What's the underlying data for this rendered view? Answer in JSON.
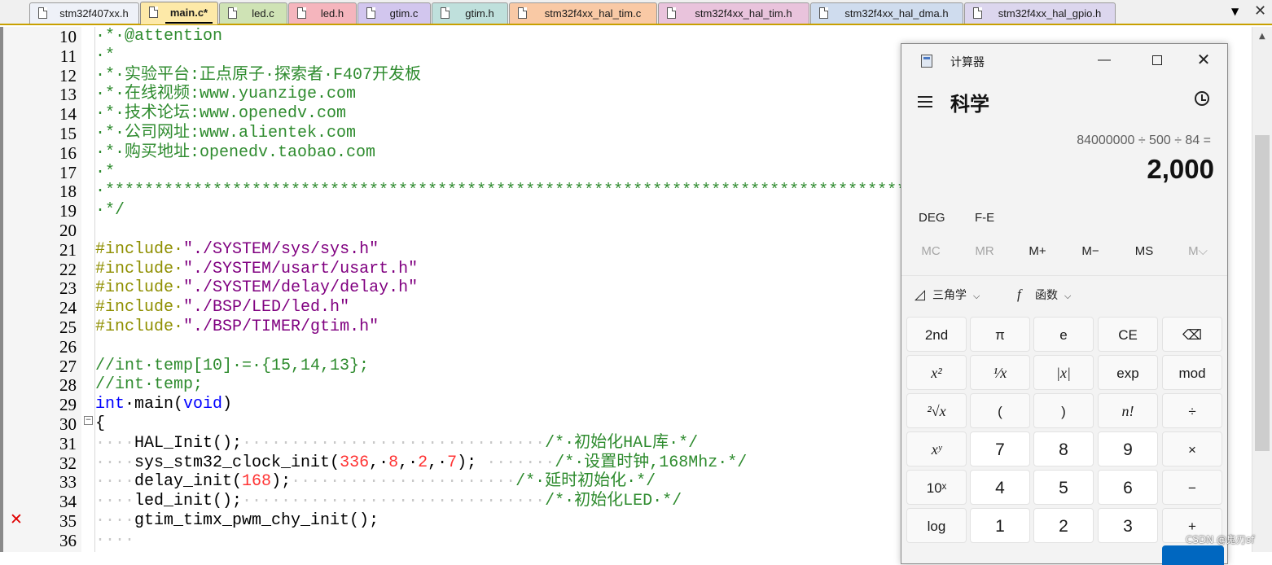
{
  "tabs": [
    {
      "label": "stm32f407xx.h",
      "color": "#eef1f8",
      "width": 135
    },
    {
      "label": "main.c*",
      "color": "#fde9a8",
      "width": 96,
      "active": true
    },
    {
      "label": "led.c",
      "color": "#cfe3b5",
      "width": 84
    },
    {
      "label": "led.h",
      "color": "#f5b5bd",
      "width": 84
    },
    {
      "label": "gtim.c",
      "color": "#d2c6ee",
      "width": 90
    },
    {
      "label": "gtim.h",
      "color": "#bfe0dc",
      "width": 94
    },
    {
      "label": "stm32f4xx_hal_tim.c",
      "color": "#f9c9a5",
      "width": 182
    },
    {
      "label": "stm32f4xx_hal_tim.h",
      "color": "#e9c3dc",
      "width": 186
    },
    {
      "label": "stm32f4xx_hal_dma.h",
      "color": "#cfdcee",
      "width": 188
    },
    {
      "label": "stm32f4xx_hal_gpio.h",
      "color": "#dcd6ee",
      "width": 186
    }
  ],
  "tabbar": {
    "dropdown_icon": "▼",
    "close_icon": "✕"
  },
  "editor": {
    "error_marker": "✕",
    "fold_marker": "−",
    "lines": [
      {
        "n": "10",
        "segs": [
          [
            "c-com",
            "·*·@attention"
          ]
        ]
      },
      {
        "n": "11",
        "segs": [
          [
            "c-com",
            "·*"
          ]
        ]
      },
      {
        "n": "12",
        "segs": [
          [
            "c-com",
            "·*·实验平台:正点原子·探索者·F407开发板"
          ]
        ]
      },
      {
        "n": "13",
        "segs": [
          [
            "c-com",
            "·*·在线视频:www.yuanzige.com"
          ]
        ]
      },
      {
        "n": "14",
        "segs": [
          [
            "c-com",
            "·*·技术论坛:www.openedv.com"
          ]
        ]
      },
      {
        "n": "15",
        "segs": [
          [
            "c-com",
            "·*·公司网址:www.alientek.com"
          ]
        ]
      },
      {
        "n": "16",
        "segs": [
          [
            "c-com",
            "·*·购买地址:openedv.taobao.com"
          ]
        ]
      },
      {
        "n": "17",
        "segs": [
          [
            "c-com",
            "·*"
          ]
        ]
      },
      {
        "n": "18",
        "segs": [
          [
            "c-com",
            "·**********************************************************************************************"
          ]
        ]
      },
      {
        "n": "19",
        "segs": [
          [
            "c-com",
            "·*/"
          ]
        ]
      },
      {
        "n": "20",
        "segs": []
      },
      {
        "n": "21",
        "segs": [
          [
            "c-pre",
            "#include·"
          ],
          [
            "c-str",
            "\"./SYSTEM/sys/sys.h\""
          ]
        ]
      },
      {
        "n": "22",
        "segs": [
          [
            "c-pre",
            "#include·"
          ],
          [
            "c-str",
            "\"./SYSTEM/usart/usart.h\""
          ]
        ]
      },
      {
        "n": "23",
        "segs": [
          [
            "c-pre",
            "#include·"
          ],
          [
            "c-str",
            "\"./SYSTEM/delay/delay.h\""
          ]
        ]
      },
      {
        "n": "24",
        "segs": [
          [
            "c-pre",
            "#include·"
          ],
          [
            "c-str",
            "\"./BSP/LED/led.h\""
          ]
        ]
      },
      {
        "n": "25",
        "segs": [
          [
            "c-pre",
            "#include·"
          ],
          [
            "c-str",
            "\"./BSP/TIMER/gtim.h\""
          ]
        ]
      },
      {
        "n": "26",
        "segs": []
      },
      {
        "n": "27",
        "segs": [
          [
            "c-com",
            "//int·temp[10]·=·{15,14,13};"
          ]
        ]
      },
      {
        "n": "28",
        "segs": [
          [
            "c-com",
            "//int·temp;"
          ]
        ]
      },
      {
        "n": "29",
        "segs": [
          [
            "c-kw",
            "int"
          ],
          [
            "",
            "·main("
          ],
          [
            "c-kw",
            "void"
          ],
          [
            "",
            ")"
          ]
        ]
      },
      {
        "n": "30",
        "segs": [
          [
            "",
            "{"
          ]
        ]
      },
      {
        "n": "31",
        "segs": [
          [
            "c-dot",
            "····"
          ],
          [
            "",
            "HAL_Init();"
          ],
          [
            "c-dot",
            "·······························"
          ],
          [
            "c-com",
            "/*·初始化HAL库·*/"
          ]
        ]
      },
      {
        "n": "32",
        "segs": [
          [
            "c-dot",
            "····"
          ],
          [
            "",
            "sys_stm32_clock_init("
          ],
          [
            "c-num",
            "336"
          ],
          [
            "",
            ",·"
          ],
          [
            "c-num",
            "8"
          ],
          [
            "",
            ",·"
          ],
          [
            "c-num",
            "2"
          ],
          [
            "",
            ",·"
          ],
          [
            "c-num",
            "7"
          ],
          [
            "",
            "); "
          ],
          [
            "c-dot",
            "·······"
          ],
          [
            "c-com",
            "/*·设置时钟,168Mhz·*/"
          ]
        ]
      },
      {
        "n": "33",
        "segs": [
          [
            "c-dot",
            "····"
          ],
          [
            "",
            "delay_init("
          ],
          [
            "c-num",
            "168"
          ],
          [
            "",
            ");"
          ],
          [
            "c-dot",
            "·······················"
          ],
          [
            "c-com",
            "/*·延时初始化·*/"
          ]
        ]
      },
      {
        "n": "34",
        "segs": [
          [
            "c-dot",
            "····"
          ],
          [
            "",
            "led_init();"
          ],
          [
            "c-dot",
            "·······························"
          ],
          [
            "c-com",
            "/*·初始化LED·*/"
          ]
        ]
      },
      {
        "n": "35",
        "segs": [
          [
            "c-dot",
            "····"
          ],
          [
            "",
            "gtim_timx_pwm_chy_init();"
          ]
        ]
      },
      {
        "n": "36",
        "segs": [
          [
            "c-dot",
            "····"
          ]
        ]
      }
    ]
  },
  "calculator": {
    "title": "计算器",
    "minimize_icon": "—",
    "close_icon": "✕",
    "mode": "科学",
    "expression": "84000000 ÷ 500 ÷ 84 =",
    "result": "2,000",
    "options": [
      "DEG",
      "F-E"
    ],
    "memory": [
      "MC",
      "MR",
      "M+",
      "M−",
      "MS",
      "M⌵"
    ],
    "trig_icon": "◿",
    "trig_label": "三角学",
    "func_icon": "f",
    "func_label": "函数",
    "chevron": "⌵",
    "keys": [
      [
        "2nd",
        "π",
        "e",
        "CE",
        "⌫"
      ],
      [
        "x²",
        "¹⁄x",
        "|x|",
        "exp",
        "mod"
      ],
      [
        "²√x",
        "(",
        ")",
        "n!",
        "÷"
      ],
      [
        "xʸ",
        "7",
        "8",
        "9",
        "×"
      ],
      [
        "10ˣ",
        "4",
        "5",
        "6",
        "−"
      ],
      [
        "log",
        "1",
        "2",
        "3",
        "+"
      ]
    ]
  },
  "watermark": "CSDN @鬼刃sf"
}
